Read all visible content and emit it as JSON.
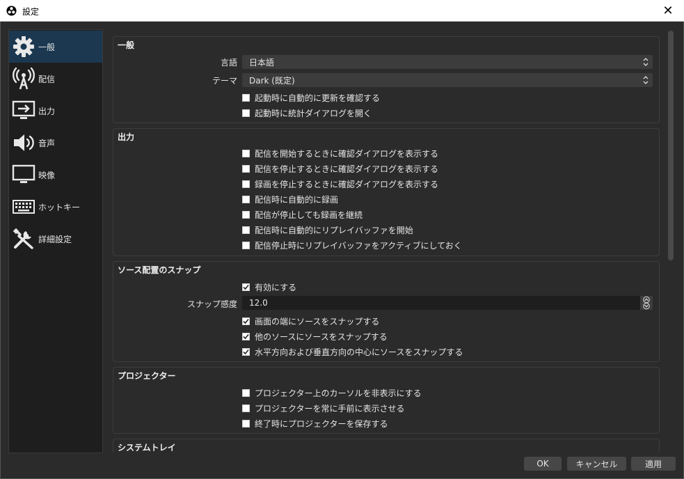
{
  "window": {
    "title": "設定",
    "close_glyph": "✕",
    "app_icon": "obs-logo-icon"
  },
  "sidebar": {
    "items": [
      {
        "label": "一般",
        "icon": "gear-icon",
        "active": true
      },
      {
        "label": "配信",
        "icon": "broadcast-antenna-icon",
        "active": false
      },
      {
        "label": "出力",
        "icon": "output-monitor-icon",
        "active": false
      },
      {
        "label": "音声",
        "icon": "speaker-icon",
        "active": false
      },
      {
        "label": "映像",
        "icon": "monitor-icon",
        "active": false
      },
      {
        "label": "ホットキー",
        "icon": "keyboard-icon",
        "active": false
      },
      {
        "label": "詳細設定",
        "icon": "tools-icon",
        "active": false
      }
    ]
  },
  "general": {
    "title": "一般",
    "language_label": "言語",
    "language_value": "日本語",
    "theme_label": "テーマ",
    "theme_value": "Dark (既定)",
    "checks": [
      {
        "label": "起動時に自動的に更新を確認する",
        "checked": false
      },
      {
        "label": "起動時に統計ダイアログを開く",
        "checked": false
      }
    ]
  },
  "output": {
    "title": "出力",
    "checks": [
      {
        "label": "配信を開始するときに確認ダイアログを表示する",
        "checked": false
      },
      {
        "label": "配信を停止するときに確認ダイアログを表示する",
        "checked": false
      },
      {
        "label": "録画を停止するときに確認ダイアログを表示する",
        "checked": false
      },
      {
        "label": "配信時に自動的に録画",
        "checked": false
      },
      {
        "label": "配信が停止しても録画を継続",
        "checked": false
      },
      {
        "label": "配信時に自動的にリプレイバッファを開始",
        "checked": false
      },
      {
        "label": "配信停止時にリプレイバッファをアクティブにしておく",
        "checked": false
      }
    ]
  },
  "snap": {
    "title": "ソース配置のスナップ",
    "enable": {
      "label": "有効にする",
      "checked": true
    },
    "sensitivity_label": "スナップ感度",
    "sensitivity_value": "12.0",
    "checks": [
      {
        "label": "画面の端にソースをスナップする",
        "checked": true
      },
      {
        "label": "他のソースにソースをスナップする",
        "checked": true
      },
      {
        "label": "水平方向および垂直方向の中心にソースをスナップする",
        "checked": true
      }
    ]
  },
  "projector": {
    "title": "プロジェクター",
    "checks": [
      {
        "label": "プロジェクター上のカーソルを非表示にする",
        "checked": false
      },
      {
        "label": "プロジェクターを常に手前に表示させる",
        "checked": false
      },
      {
        "label": "終了時にプロジェクターを保存する",
        "checked": false
      }
    ]
  },
  "systray": {
    "title": "システムトレイ"
  },
  "buttons": {
    "ok": "OK",
    "cancel": "キャンセル",
    "apply": "適用"
  },
  "colors": {
    "accent_active": "#1b3850",
    "background": "#2b2b2b",
    "sidebar": "#1e1e1e"
  }
}
